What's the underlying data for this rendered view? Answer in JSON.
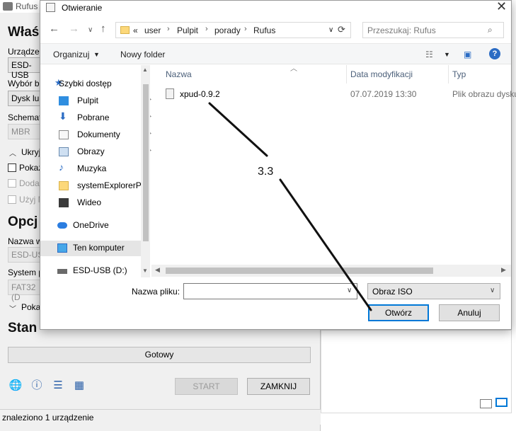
{
  "rufus": {
    "title": "Rufus",
    "heading_props": "Właś",
    "label_device": "Urządzen",
    "device_value": "ESD-USB",
    "label_boot": "Wybór b",
    "boot_value": "Dysk lub",
    "label_scheme": "Schemat",
    "scheme_value": "MBR",
    "advanced_toggle": "Ukryj",
    "check_show": "Pokaż",
    "check_add": "Doda",
    "check_use": "Użyj N",
    "heading_options": "Opcj",
    "label_volume": "Nazwa w",
    "volume_value": "ESD-US",
    "label_fs": "System p",
    "fs_value": "FAT32 (D",
    "advanced_format": "Poka",
    "heading_status": "Stan",
    "status_ready": "Gotowy",
    "start_button": "START",
    "close_button": "ZAMKNIJ",
    "footer_status": "znaleziono 1 urządzenie"
  },
  "dialog": {
    "title": "Otwieranie",
    "breadcrumb": [
      "user",
      "Pulpit",
      "porady",
      "Rufus"
    ],
    "breadcrumb_prefix": "«",
    "search_placeholder": "Przeszukaj: Rufus",
    "toolbar": {
      "organize": "Organizuj",
      "new_folder": "Nowy folder"
    },
    "nav": [
      {
        "label": "Szybki dostęp",
        "icon": "star-icon"
      },
      {
        "label": "Pulpit",
        "icon": "desktop-icon",
        "pinned": true
      },
      {
        "label": "Pobrane",
        "icon": "download-icon",
        "pinned": true
      },
      {
        "label": "Dokumenty",
        "icon": "document-icon",
        "pinned": true
      },
      {
        "label": "Obrazy",
        "icon": "pictures-icon",
        "pinned": true
      },
      {
        "label": "Muzyka",
        "icon": "music-icon"
      },
      {
        "label": "systemExplorerP",
        "icon": "folder-icon"
      },
      {
        "label": "Wideo",
        "icon": "video-icon"
      },
      {
        "label": "OneDrive",
        "icon": "cloud-icon"
      },
      {
        "label": "Ten komputer",
        "icon": "computer-icon"
      },
      {
        "label": "ESD-USB (D:)",
        "icon": "drive-icon"
      }
    ],
    "columns": {
      "name": "Nazwa",
      "modified": "Data modyfikacji",
      "type": "Typ"
    },
    "files": [
      {
        "name": "xpud-0.9.2",
        "modified": "07.07.2019 13:30",
        "type": "Plik obrazu dysku"
      }
    ],
    "filename_label": "Nazwa pliku:",
    "filename_value": "",
    "filetype_value": "Obraz ISO",
    "open_button": "Otwórz",
    "cancel_button": "Anuluj"
  },
  "annotation": {
    "label": "3.3"
  },
  "colors": {
    "accent": "#0078d7",
    "help": "#2b6cc4",
    "folder": "#fcd87a"
  }
}
